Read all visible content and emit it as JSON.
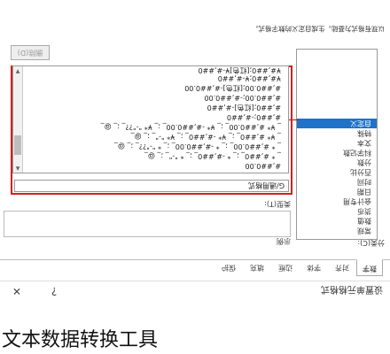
{
  "dialog": {
    "title": "设置单元格格式",
    "help_symbol": "?",
    "close_symbol": "✕"
  },
  "tabs": [
    "数字",
    "对齐",
    "字体",
    "边框",
    "填充",
    "保护"
  ],
  "category": {
    "label": "分类(C):",
    "items": [
      "常规",
      "数值",
      "货币",
      "会计专用",
      "日期",
      "时间",
      "百分比",
      "分数",
      "科学记数",
      "文本",
      "特殊",
      "自定义"
    ],
    "selected": "自定义"
  },
  "sample": {
    "label": "示例"
  },
  "type_section": {
    "label": "类型(T):",
    "value": "G/通用格式",
    "formats": [
      "#,##0.00",
      "_ * #,##0_ ;_ * -#,##0_ ;_ * \"-\"_ ;_ @_",
      "_ * #,##0.00_ ;_ * -#,##0.00_ ;_ * \"-\"??_ ;_ @_",
      "_ ¥* #,##0_ ;_ ¥* -#,##0_ ;_ ¥* \"-\"_ ;_ @_",
      "_ ¥* #,##0.00_ ;_ ¥* -#,##0.00_ ;_ ¥* \"-\"??_ ;_ @_",
      "#,##0;-#,##0",
      "#,##0;[红色]-#,##0",
      "#,##0.00;-#,##0.00",
      "#,##0.00;[红色]-#,##0.00",
      "¥#,##0;¥-#,##0",
      "¥#,##0;[红色]¥-#,##0"
    ]
  },
  "delete_button": "删除(D)",
  "description": "以现有格式为基础，生成自定义的数字格式。",
  "caption": "文本数据转换工具"
}
